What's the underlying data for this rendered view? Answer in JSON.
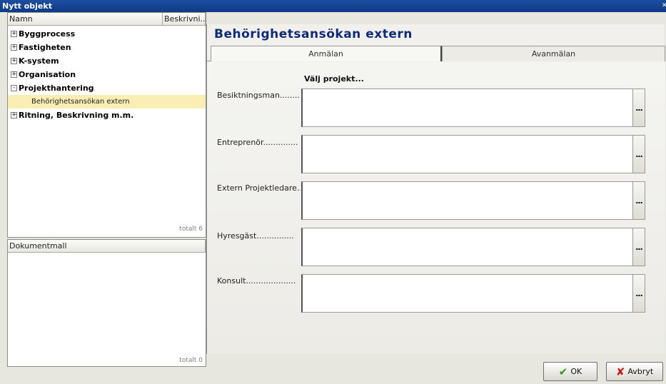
{
  "window": {
    "title": "Nytt objekt"
  },
  "tree_pane": {
    "col_name": "Namn",
    "col_desc": "Beskrivni...",
    "items": [
      {
        "toggle": "+",
        "label": "Byggprocess"
      },
      {
        "toggle": "+",
        "label": "Fastigheten"
      },
      {
        "toggle": "+",
        "label": "K-system"
      },
      {
        "toggle": "+",
        "label": "Organisation"
      },
      {
        "toggle": "-",
        "label": "Projekthantering"
      },
      {
        "toggle": "+",
        "label": "Ritning, Beskrivning m.m."
      }
    ],
    "selected_child": "Behörighetsansökan extern",
    "total": "totalt 6"
  },
  "doc_pane": {
    "col_name": "Dokumentmall",
    "total": "totalt 0"
  },
  "form": {
    "title": "Behörighetsansökan extern",
    "tabs": [
      "Anmälan",
      "Avanmälan"
    ],
    "select_project": "Välj projekt...",
    "fields": [
      {
        "label": "Besiktningsman........"
      },
      {
        "label": "Entreprenör.............."
      },
      {
        "label": "Extern Projektledare..."
      },
      {
        "label": "Hyresgäst..............."
      },
      {
        "label": "Konsult...................."
      }
    ],
    "browse_label": "..."
  },
  "buttons": {
    "ok": "OK",
    "cancel": "Avbryt"
  },
  "colors": {
    "titlebar": "#0e3a86",
    "form_title": "#0f2a78",
    "selected_row": "#fbeeb5",
    "ok_icon": "#2e9a1a",
    "cancel_icon": "#c91818"
  }
}
